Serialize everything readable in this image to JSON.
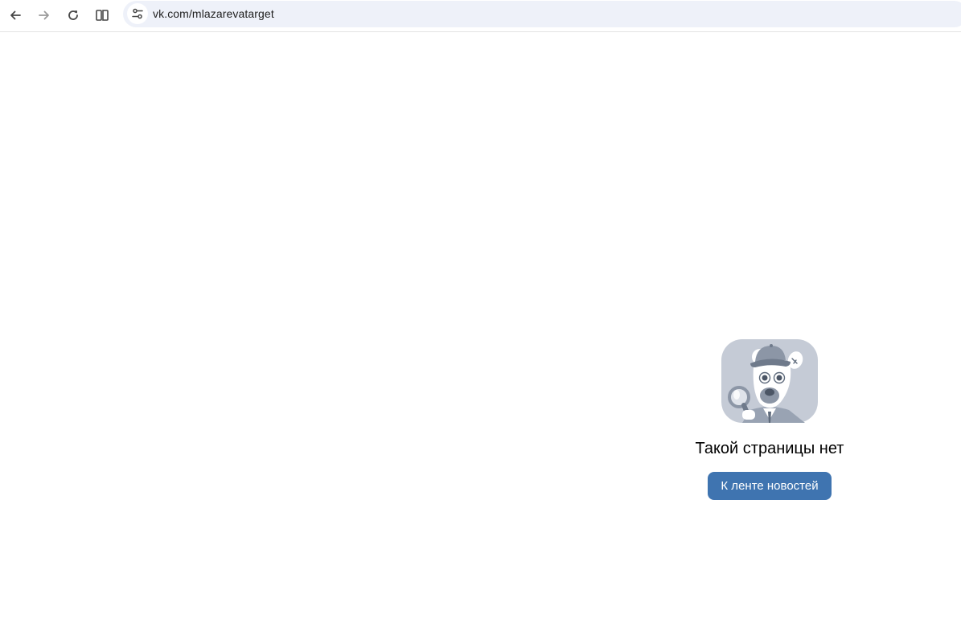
{
  "browser": {
    "url": "vk.com/mlazarevatarget",
    "icons": {
      "back": "arrow-left-icon",
      "forward": "arrow-right-icon",
      "reload": "reload-icon",
      "split": "split-view-icon",
      "site_info": "tune-icon"
    }
  },
  "error_page": {
    "title": "Такой страницы нет",
    "button_label": "К ленте новостей",
    "illustration": "detective-dog-icon"
  },
  "colors": {
    "button": "#3f74b0",
    "omnibox": "#eef1f9",
    "illustration_bg": "#c5cbd6"
  }
}
